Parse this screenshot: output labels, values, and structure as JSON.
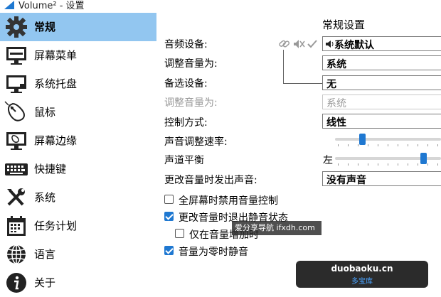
{
  "window": {
    "title": "Volume² - 设置"
  },
  "sidebar": {
    "items": [
      {
        "label": "常规",
        "icon": "gear-icon",
        "active": true
      },
      {
        "label": "屏幕菜单",
        "icon": "monitor-icon",
        "active": false
      },
      {
        "label": "系统托盘",
        "icon": "tray-monitor-icon",
        "active": false
      },
      {
        "label": "鼠标",
        "icon": "mouse-icon",
        "active": false
      },
      {
        "label": "屏幕边缘",
        "icon": "screen-edge-icon",
        "active": false
      },
      {
        "label": "快捷键",
        "icon": "keyboard-icon",
        "active": false
      },
      {
        "label": "系统",
        "icon": "tools-icon",
        "active": false
      },
      {
        "label": "任务计划",
        "icon": "calendar-icon",
        "active": false
      },
      {
        "label": "语言",
        "icon": "globe-icon",
        "active": false
      },
      {
        "label": "关于",
        "icon": "info-icon",
        "active": false
      }
    ]
  },
  "main": {
    "section_title": "常规设置",
    "audio_device": {
      "label": "音频设备:",
      "value": "系统默认"
    },
    "adjust_volume": {
      "label": "调整音量为:",
      "value": "系统"
    },
    "alt_device": {
      "label": "备选设备:",
      "value": "无"
    },
    "alt_adjust_volume": {
      "label": "调整音量为:",
      "value": "系统",
      "disabled": true
    },
    "control_mode": {
      "label": "控制方式:",
      "value": "线性"
    },
    "rate": {
      "label": "声音调整速率:",
      "level": 0.24
    },
    "balance": {
      "label": "声道平衡",
      "left_label": "左",
      "level": 0.86
    },
    "sound_on_change": {
      "label": "更改音量时发出声音:",
      "value": "没有声音"
    },
    "checkboxes": [
      {
        "label": "全屏幕时禁用音量控制",
        "checked": false
      },
      {
        "label": "更改音量时退出静音状态",
        "checked": true
      },
      {
        "label": "仅在音量增加时",
        "checked": false
      },
      {
        "label": "音量为零时静音",
        "checked": true
      }
    ]
  },
  "watermarks": {
    "top": "爱分享导航 ifxdh.com",
    "bottom_site": "duobaoku.cn",
    "bottom_name": "多宝库"
  },
  "colors": {
    "accent": "#1f78d1",
    "sidebar_active": "#92c6f0"
  }
}
